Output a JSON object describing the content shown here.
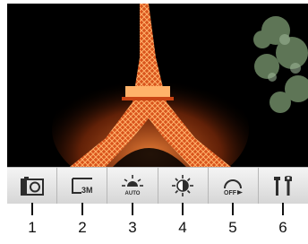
{
  "toolbar": {
    "buttons": [
      {
        "icon": "camera-mode-icon",
        "number": "1"
      },
      {
        "icon": "resolution-icon",
        "text": "3M",
        "number": "2"
      },
      {
        "icon": "white-balance-icon",
        "text": "AUTO",
        "number": "3"
      },
      {
        "icon": "brightness-icon",
        "number": "4"
      },
      {
        "icon": "self-timer-icon",
        "text": "OFF",
        "number": "5"
      },
      {
        "icon": "tools-icon",
        "number": "6"
      }
    ]
  },
  "colors": {
    "accent": "#0b7ec2",
    "tower": "#e35a1e",
    "viewfinder_bg": "#000000"
  }
}
